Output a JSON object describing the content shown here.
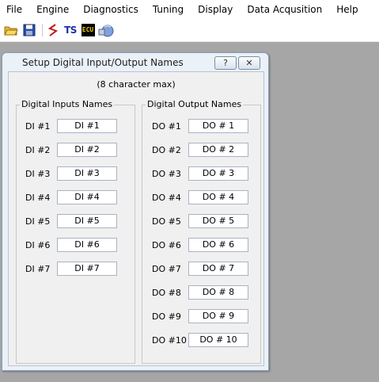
{
  "menu": [
    "File",
    "Engine",
    "Diagnostics",
    "Tuning",
    "Display",
    "Data Acqusition",
    "Help"
  ],
  "toolbar": {
    "icons": [
      "open-folder-icon",
      "save-disk-icon",
      "graph-icon",
      "ts-icon",
      "ecu-icon",
      "network-icon"
    ],
    "ts_label": "TS",
    "ecu_label": "ECU"
  },
  "dialog": {
    "title": "Setup Digital Input/Output Names",
    "help_button": "?",
    "close_button": "✕",
    "subtitle": "(8 character max)",
    "inputs_group": "Digital Inputs Names",
    "outputs_group": "Digital Output Names",
    "inputs": [
      {
        "label": "DI #1",
        "value": "DI #1"
      },
      {
        "label": "DI #2",
        "value": "DI #2"
      },
      {
        "label": "DI #3",
        "value": "DI #3"
      },
      {
        "label": "DI #4",
        "value": "DI #4"
      },
      {
        "label": "DI #5",
        "value": "DI #5"
      },
      {
        "label": "DI #6",
        "value": "DI #6"
      },
      {
        "label": "DI #7",
        "value": "DI #7"
      }
    ],
    "outputs": [
      {
        "label": "DO #1",
        "value": "DO # 1"
      },
      {
        "label": "DO #2",
        "value": "DO # 2"
      },
      {
        "label": "DO #3",
        "value": "DO # 3"
      },
      {
        "label": "DO #4",
        "value": "DO # 4"
      },
      {
        "label": "DO #5",
        "value": "DO # 5"
      },
      {
        "label": "DO #6",
        "value": "DO # 6"
      },
      {
        "label": "DO #7",
        "value": "DO # 7"
      },
      {
        "label": "DO #8",
        "value": "DO # 8"
      },
      {
        "label": "DO #9",
        "value": "DO # 9"
      },
      {
        "label": "DO #10",
        "value": "DO # 10"
      }
    ]
  }
}
